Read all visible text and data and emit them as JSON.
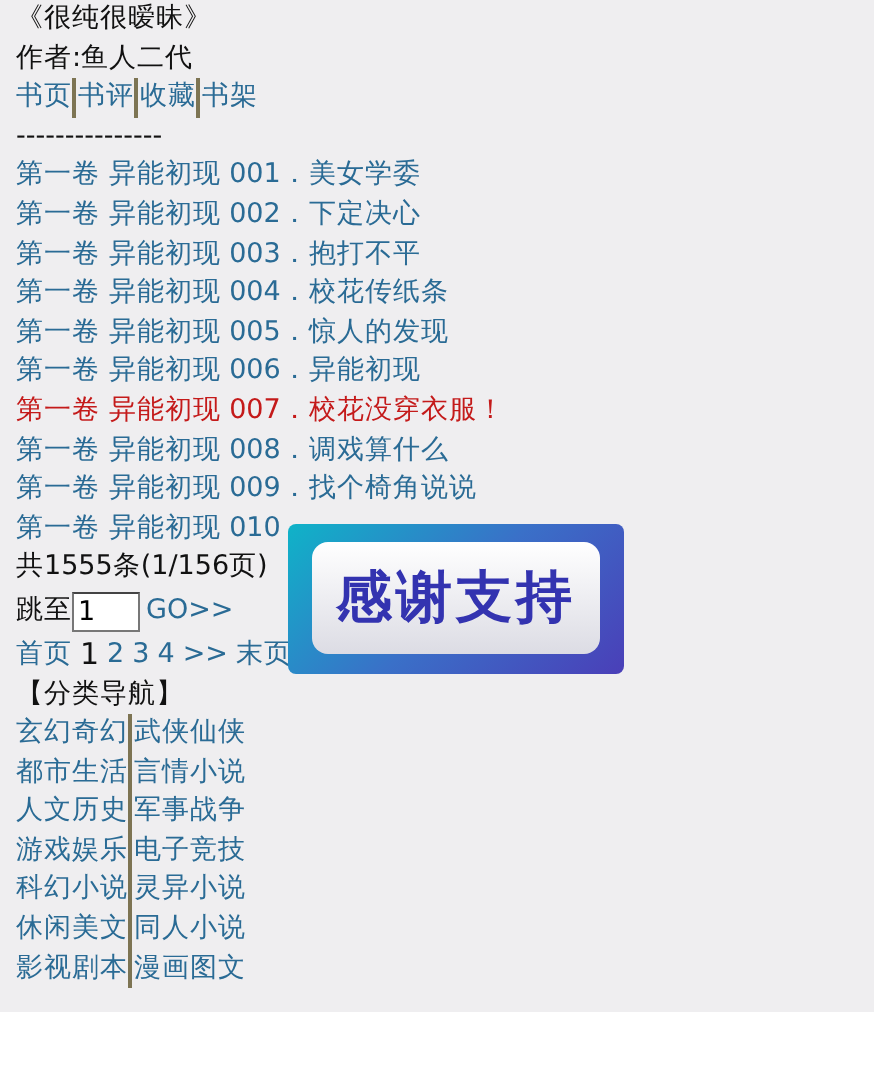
{
  "book_title": "《很纯很暧昧》",
  "author": "作者:鱼人二代",
  "nav_links": [
    "书页",
    "书评",
    "收藏",
    "书架"
  ],
  "separator": "---------------",
  "chapters": [
    {
      "label": "第一卷 异能初现 001．美女学委",
      "highlighted": false
    },
    {
      "label": "第一卷 异能初现 002．下定决心",
      "highlighted": false
    },
    {
      "label": "第一卷 异能初现 003．抱打不平",
      "highlighted": false
    },
    {
      "label": "第一卷 异能初现 004．校花传纸条",
      "highlighted": false
    },
    {
      "label": "第一卷 异能初现 005．惊人的发现",
      "highlighted": false
    },
    {
      "label": "第一卷 异能初现 006．异能初现",
      "highlighted": false
    },
    {
      "label": "第一卷 异能初现 007．校花没穿衣服！",
      "highlighted": true
    },
    {
      "label": "第一卷 异能初现 008．调戏算什么",
      "highlighted": false
    },
    {
      "label": "第一卷 异能初现 009．找个椅角说说",
      "highlighted": false
    },
    {
      "label": "第一卷 异能初现 010",
      "highlighted": false
    }
  ],
  "count": "共1555条(1/156页)",
  "jump": {
    "label": "跳至",
    "value": "1",
    "button": "GO>>"
  },
  "pages": [
    {
      "label": "首页",
      "selected": false
    },
    {
      "label": "1",
      "selected": true
    },
    {
      "label": "2",
      "selected": false
    },
    {
      "label": "3",
      "selected": false
    },
    {
      "label": "4",
      "selected": false
    },
    {
      "label": ">>",
      "selected": false
    },
    {
      "label": "末页",
      "selected": false
    }
  ],
  "category_heading": "【分类导航】",
  "categories": [
    [
      "玄幻奇幻",
      "武侠仙侠"
    ],
    [
      "都市生活",
      "言情小说"
    ],
    [
      "人文历史",
      "军事战争"
    ],
    [
      "游戏娱乐",
      "电子竞技"
    ],
    [
      "科幻小说",
      "灵异小说"
    ],
    [
      "休闲美文",
      "同人小说"
    ],
    [
      "影视剧本",
      "漫画图文"
    ]
  ],
  "overlay": {
    "label": "感谢支持"
  }
}
